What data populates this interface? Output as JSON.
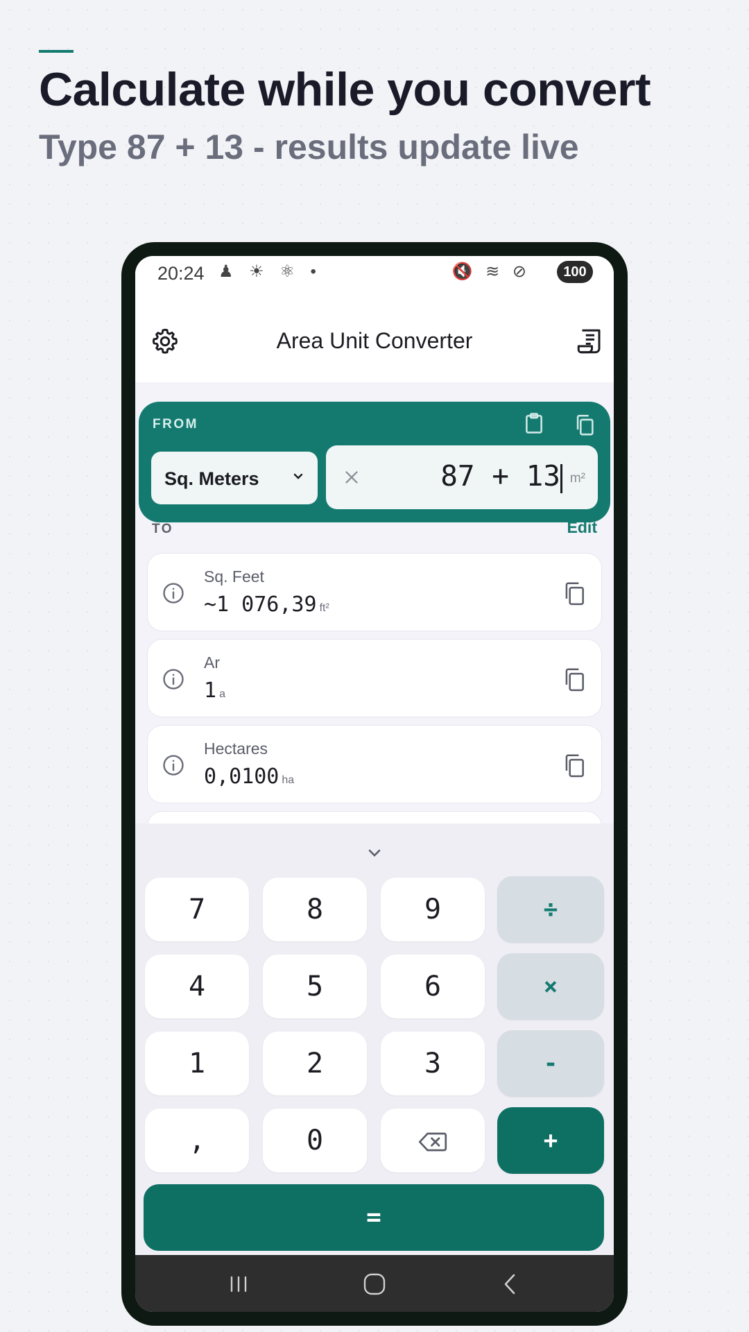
{
  "promo": {
    "headline": "Calculate while you convert",
    "subhead": "Type 87 + 13 - results update live"
  },
  "status": {
    "time": "20:24",
    "left_icons": "♟ ☀ ⚛ •",
    "right_icons": "🔇 ≋ ⊘",
    "battery": "100"
  },
  "app": {
    "title": "Area Unit Converter"
  },
  "from": {
    "label": "FROM",
    "unit": "Sq. Meters",
    "expression": "87 + 13",
    "unit_symbol": "m²"
  },
  "to": {
    "label": "TO",
    "edit_label": "Edit",
    "results": [
      {
        "name": "Sq. Feet",
        "value": "~1 076,39",
        "unit": "ft²"
      },
      {
        "name": "Ar",
        "value": "1",
        "unit": "a"
      },
      {
        "name": "Hectares",
        "value": "0,0100",
        "unit": "ha"
      }
    ]
  },
  "keypad": {
    "keys": [
      "7",
      "8",
      "9",
      "÷",
      "4",
      "5",
      "6",
      "×",
      "1",
      "2",
      "3",
      "-",
      ",",
      "0",
      "+"
    ],
    "equals": "="
  },
  "colors": {
    "accent": "#147a70",
    "accent_dark": "#0e6f63",
    "operator_bg": "#d6dde3"
  },
  "icons": {
    "settings": "gear-icon",
    "history": "receipt-icon",
    "paste": "clipboard-icon",
    "copy": "copy-icon",
    "info": "info-icon",
    "clear": "close-icon",
    "backspace": "backspace-icon",
    "collapse": "chevron-down-icon"
  }
}
